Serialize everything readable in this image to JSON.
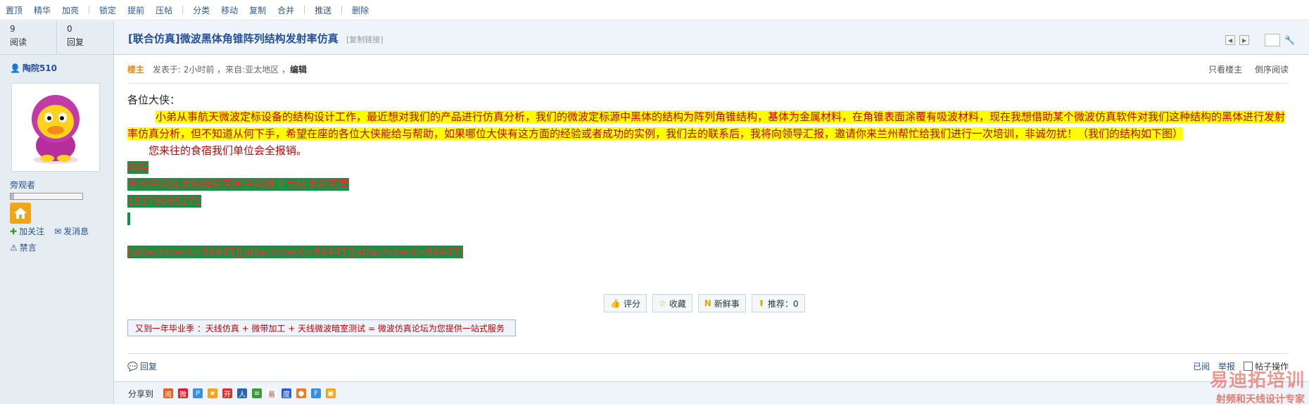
{
  "toolbar": {
    "items": [
      "置顶",
      "精华",
      "加亮",
      "锁定",
      "提前",
      "压帖",
      "分类",
      "移动",
      "复制",
      "合并",
      "推送",
      "删除"
    ]
  },
  "stats": {
    "views_num": "9",
    "views_label": "阅读",
    "replies_num": "0",
    "replies_label": "回复"
  },
  "thread": {
    "title": "[联合仿真]微波黑体角锥阵列结构发射率仿真",
    "copy_link": "[复制链接]"
  },
  "author": {
    "name": "陶院510",
    "rank": "旁观者",
    "progress_fraction": 0.05,
    "follow": "加关注",
    "message": "发消息",
    "ban": "禁言"
  },
  "post": {
    "owner_label": "楼主",
    "meta_prefix": "发表于: 2小时前 ，来自:亚太地区 ，",
    "edit": "编辑",
    "only_owner": "只看楼主",
    "reverse": "倒序阅读",
    "greeting": "各位大侠：",
    "para1": "小弟从事航天微波定标设备的结构设计工作，最近想对我们的产品进行仿真分析，我们的微波定标源中黑体的结构为阵列角锥结构，基体为金属材料，在角锥表面涂覆有吸波材料，现在我想借助某个微波仿真软件对我们这种结构的黑体进行发射率仿真分析，但不知道从何下手，希望在座的各位大侠能给与帮助，如果哪位大侠有这方面的经验或者成功的实例，我们去的联系后，我将向领导汇报，邀请你来兰州帮忙给我们进行一次培训，非诚勿扰！（我们的结构如下图）",
    "para2": "您来往的食宿我们单位会全报销。",
    "sig_name": "陶院",
    "sig_org": "兰州空间技术物理研究所空间微重力技术研究室",
    "sig_phone": "15379065271",
    "sig_attach": "[attachment=89445][attachment=89445][attachment=89445]"
  },
  "buttons": {
    "rate": "评分",
    "fav": "收藏",
    "fresh": "新鲜事",
    "recommend": "推荐：0"
  },
  "ad": "又到一年毕业季 ：天线仿真 + 微带加工 + 天线微波暗室测试 = 微波仿真论坛为您提供一站式服务",
  "reply": {
    "label": "回复",
    "read": "已阅",
    "report": "举报",
    "ops": "帖子操作"
  },
  "share": {
    "label": "分享到"
  },
  "watermark": {
    "line1": "易迪拓培训",
    "line2": "射频和天线设计专家"
  },
  "colors": {
    "link": "#27509a",
    "highlight_yellow": "#ffff00",
    "highlight_green": "#119245",
    "highlight_text": "#cc0000"
  }
}
